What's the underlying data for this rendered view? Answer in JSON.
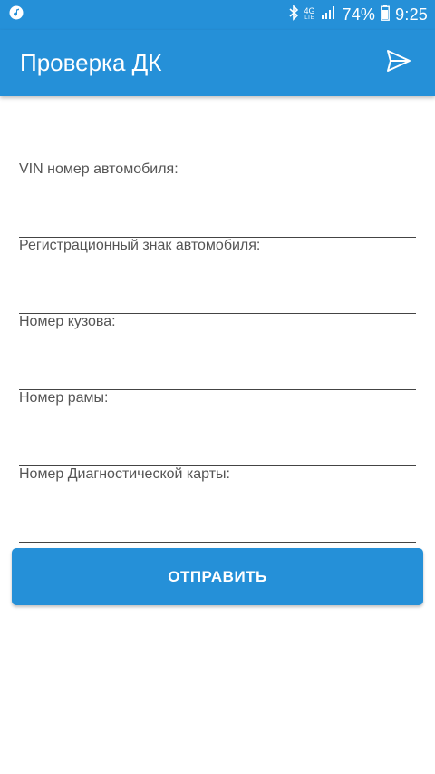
{
  "status_bar": {
    "network_top": "4G",
    "network_bottom": "LTE",
    "battery": "74%",
    "time": "9:25",
    "icons": [
      "music-note-icon",
      "bluetooth-icon",
      "signal-icon",
      "battery-icon"
    ]
  },
  "app_bar": {
    "title": "Проверка ДК",
    "action_icon": "send-icon"
  },
  "form": {
    "fields": [
      {
        "label": "VIN номер автомобиля:",
        "value": ""
      },
      {
        "label": "Регистрационный знак автомобиля:",
        "value": ""
      },
      {
        "label": "Номер кузова:",
        "value": ""
      },
      {
        "label": "Номер рамы:",
        "value": ""
      },
      {
        "label": "Номер Диагностической карты:",
        "value": ""
      }
    ]
  },
  "submit_label": "ОТПРАВИТЬ",
  "colors": {
    "primary": "#2590d8",
    "underline": "#444444",
    "label": "#555555"
  }
}
